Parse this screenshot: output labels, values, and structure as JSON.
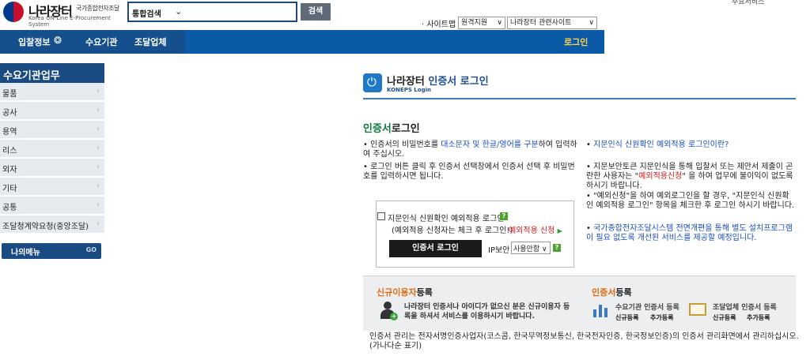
{
  "header": {
    "logo_ko": "나라장터",
    "logo_sub": "국가종합전자조달",
    "logo_en": "Korea ON-Line E-Procurement System",
    "search_select": "통합검색",
    "search_button": "검색",
    "top_note": "주요서비스",
    "sitemap": "· 사이트맵",
    "remote_support": "원격지원",
    "related_sites": "나라장터 관련사이트"
  },
  "nav": {
    "bid_info": "입찰정보",
    "agency": "수요기관",
    "vendor": "조달업체",
    "login": "로그인"
  },
  "sidebar": {
    "title": "수요기관업무",
    "items": [
      "물품",
      "공사",
      "용역",
      "리스",
      "외자",
      "기타",
      "공통",
      "조달청계약요청(중앙조달)"
    ],
    "my_menu": "나의메뉴",
    "my_menu_go": "GO"
  },
  "content": {
    "title_prefix": "나라장터",
    "title_highlight": "인증서 로그인",
    "title_sub": "KONEPS Login",
    "section_highlight": "인증서",
    "section_rest": "로그인",
    "bullets_left": [
      {
        "pre": "인증서의 비밀번호를 ",
        "blue": "대소문자 및 한글/영어를 구분",
        "post": "하여 입력하여 주십시오."
      },
      {
        "pre": "로그인 버튼 클릭 후 인증서 선택창에서 인증서 선택 후 비밀번호를 입력하시면 됩니다.",
        "blue": "",
        "post": ""
      }
    ],
    "bullets_right": {
      "r1": "지문인식 신원확인 예외적용 로그인이란?",
      "r2_pre": "지문보안토큰 지문인식을 통해 입찰서 또는 제안서 제출이 곤란한 사용자는 \"",
      "r2_red": "예외적용신청",
      "r2_post": "\" 을 하여 업무에 불이익이 없도록 하시기 바랍니다.",
      "r3": "\"예외신청\"을 하여 예외로그인을 할 경우, \"지문인식 신원확인 예외적용 로그인\" 항목을 체크한 후 로그인 하시기 바랍니다.",
      "r4": "국가종합전자조달시스템 전면개편을 통해 별도 설치프로그램이 필요 없도록 개선된 서비스를 제공할 예정입니다."
    },
    "login_box": {
      "fp_label": "지문인식 신원확인 예외적용 로그인",
      "fp_note": "(예외적용 신청자는 체크 후 로그인!)",
      "fp_apply": "예외적용 신청",
      "login_button": "인증서 로그인",
      "ip_label": "IP보안",
      "ip_value": "사용안함",
      "help": "?"
    },
    "register": {
      "new_highlight": "신규이용자",
      "new_rest": "등록",
      "new_desc": "나라장터 인증서나 아이디가 없으신 분은 신규이용자 등록을 하셔서 서비스를 이용하시기 바랍니다.",
      "cert_highlight": "인증서",
      "cert_rest": "등록",
      "agency_label": "수요기관 인증서 등록",
      "vendor_label": "조달업체 인증서 등록",
      "new_reg": "신규등록",
      "add_reg": "추가등록"
    },
    "footer_note": "인증서 관리는 전자서명인증사업자(코스콤, 한국무역정보통신, 한국전자인증, 한국정보인증)의 인증서 관리화면에서 관리하십시오. (가나다순 표기)"
  },
  "colors": {
    "nav_blue": "#0b5aa8",
    "sidebar_navy": "#1a4a82",
    "login_yellow": "#ffd24a",
    "accent_green": "#0f7a3c",
    "accent_orange": "#e16a12"
  }
}
